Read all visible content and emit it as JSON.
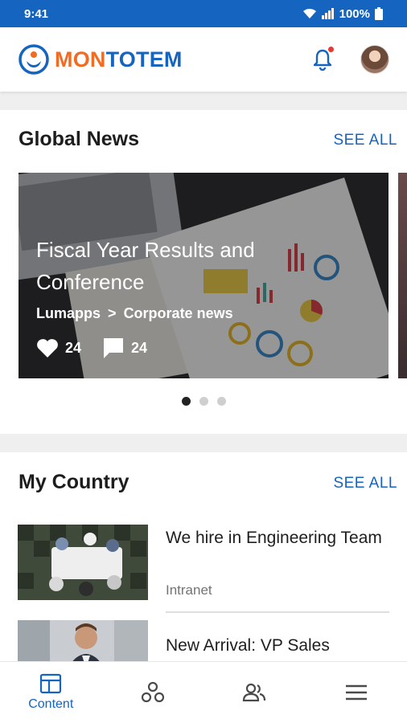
{
  "status_bar": {
    "time": "9:41",
    "battery": "100%"
  },
  "header": {
    "logo_part1": "MON",
    "logo_part2": "TOTEM"
  },
  "global_news": {
    "title": "Global News",
    "see_all": "SEE ALL",
    "featured": {
      "title": "Fiscal Year Results and Conference",
      "source": "Lumapps",
      "separator": ">",
      "category": "Corporate news",
      "likes": "24",
      "comments": "24"
    },
    "carousel_pages": 3,
    "active_page": 1
  },
  "my_country": {
    "title": "My Country",
    "see_all": "SEE ALL",
    "items": [
      {
        "title": "We hire in Engineering Team",
        "subtitle": "Intranet"
      },
      {
        "title": "New Arrival: VP Sales",
        "subtitle": ""
      }
    ]
  },
  "bottom_nav": {
    "items": [
      {
        "label": "Content",
        "icon": "content-icon",
        "active": true
      },
      {
        "label": "",
        "icon": "communities-icon",
        "active": false
      },
      {
        "label": "",
        "icon": "people-icon",
        "active": false
      },
      {
        "label": "",
        "icon": "menu-icon",
        "active": false
      }
    ]
  },
  "colors": {
    "primary": "#1565c0",
    "brand_orange": "#f26b22",
    "notification": "#e53935"
  }
}
